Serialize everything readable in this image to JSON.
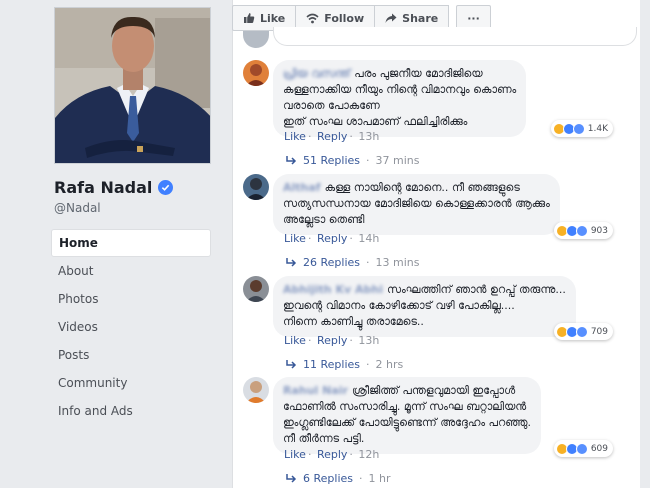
{
  "toolbar": {
    "like_label": "Like",
    "follow_label": "Follow",
    "share_label": "Share",
    "more_label": "···"
  },
  "profile": {
    "name": "Rafa Nadal",
    "handle": "@Nadal"
  },
  "sidebar": {
    "items": [
      {
        "label": "Home",
        "active": true
      },
      {
        "label": "About"
      },
      {
        "label": "Photos"
      },
      {
        "label": "Videos"
      },
      {
        "label": "Posts"
      },
      {
        "label": "Community"
      },
      {
        "label": "Info and Ads"
      }
    ]
  },
  "comments": [
    {
      "author": "പ്രിയ വസന്ത്",
      "lines": [
        "പരം പുജനീയ മോദിജിയെ",
        "കള്ളനാക്കിയ നീയും നിന്റെ വിമാനവും കൊണം",
        "വരാതെ പോകണേ",
        "ഇത് സംഘ ശാപമാണ് ഫലിച്ചിരിക്കും"
      ],
      "actions": {
        "like": "Like",
        "reply": "Reply",
        "time": "13h"
      },
      "reactions": "1.4K",
      "replies": {
        "label": "51 Replies",
        "time": "37 mins"
      }
    },
    {
      "author": "Althaf",
      "lines": [
        "കള്ള നായിന്റെ മോനെ.. നീ ഞങ്ങളുടെ",
        "സത്യസന്ധനായ മോദിജിയെ കൊള്ളക്കാരൻ ആക്കും",
        "അല്ലേടാ തെണ്ടി"
      ],
      "actions": {
        "like": "Like",
        "reply": "Reply",
        "time": "14h"
      },
      "reactions": "903",
      "replies": {
        "label": "26 Replies",
        "time": "13 mins"
      }
    },
    {
      "author": "Abhijith Kv Abhi",
      "lines": [
        "സംഘത്തിന് ഞാൻ ഉറപ്പ് തരുന്നു...",
        "ഇവന്റെ വിമാനം കോഴിക്കോട് വഴി പോകില്ല....",
        "നിന്നെ കാണിച്ചു തരാമേടെ.."
      ],
      "actions": {
        "like": "Like",
        "reply": "Reply",
        "time": "13h"
      },
      "reactions": "709",
      "replies": {
        "label": "11 Replies",
        "time": "2 hrs"
      }
    },
    {
      "author": "Rahul Nair",
      "lines": [
        "ശ്രീജിത്ത് പന്തളവുമായി ഇപ്പോൾ",
        "ഫോണിൽ സംസാരിച്ചു. മൂന്ന് സംഘ ബറ്റാലിയൻ",
        "ഇംഗ്ലണ്ടിലേക്ക് പോയിട്ടുണ്ടെന്ന് അദ്ദേഹം പറഞ്ഞു.",
        "നീ തീർന്നട പട്ടി."
      ],
      "actions": {
        "like": "Like",
        "reply": "Reply",
        "time": "12h"
      },
      "reactions": "609",
      "replies": {
        "label": "6 Replies",
        "time": "1 hr"
      }
    }
  ],
  "colors": {
    "link": "#385898",
    "meta": "#90949c",
    "page_bg": "#e9ebee",
    "bubble_bg": "#f2f3f5",
    "verified": "#4080ff"
  }
}
